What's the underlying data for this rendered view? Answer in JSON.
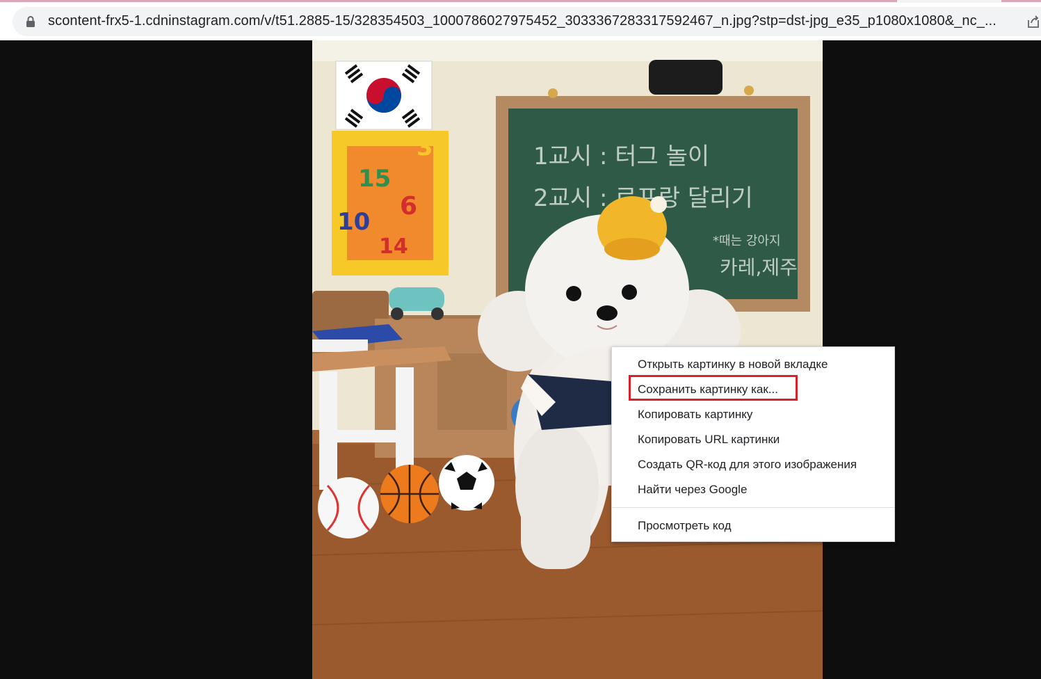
{
  "browser": {
    "url": "scontent-frx5-1.cdninstagram.com/v/t51.2885-15/328354503_1000786027975452_3033367283317592467_n.jpg?stp=dst-jpg_e35_p1080x1080&_nc_...",
    "icons": {
      "lock": "lock-icon",
      "share": "share-icon"
    }
  },
  "photo": {
    "description_icon": "dog-photo",
    "chalkboard_lines": [
      "1교시 : 터그 놀이",
      "2교시 : 로프랑 달리기"
    ],
    "chalkboard_note": [
      "*때는 강아지",
      "카레,제주"
    ],
    "block_numbers": [
      "3",
      "15",
      "6",
      "10",
      "14"
    ]
  },
  "context_menu": {
    "items": [
      {
        "label": "Открыть картинку в новой вкладке"
      },
      {
        "label": "Сохранить картинку как..."
      },
      {
        "label": "Копировать картинку"
      },
      {
        "label": "Копировать URL картинки"
      },
      {
        "label": "Создать QR-код для этого изображения"
      },
      {
        "label": "Найти через Google"
      },
      {
        "label": "Просмотреть код"
      }
    ],
    "highlight_color": "#d9212b"
  }
}
